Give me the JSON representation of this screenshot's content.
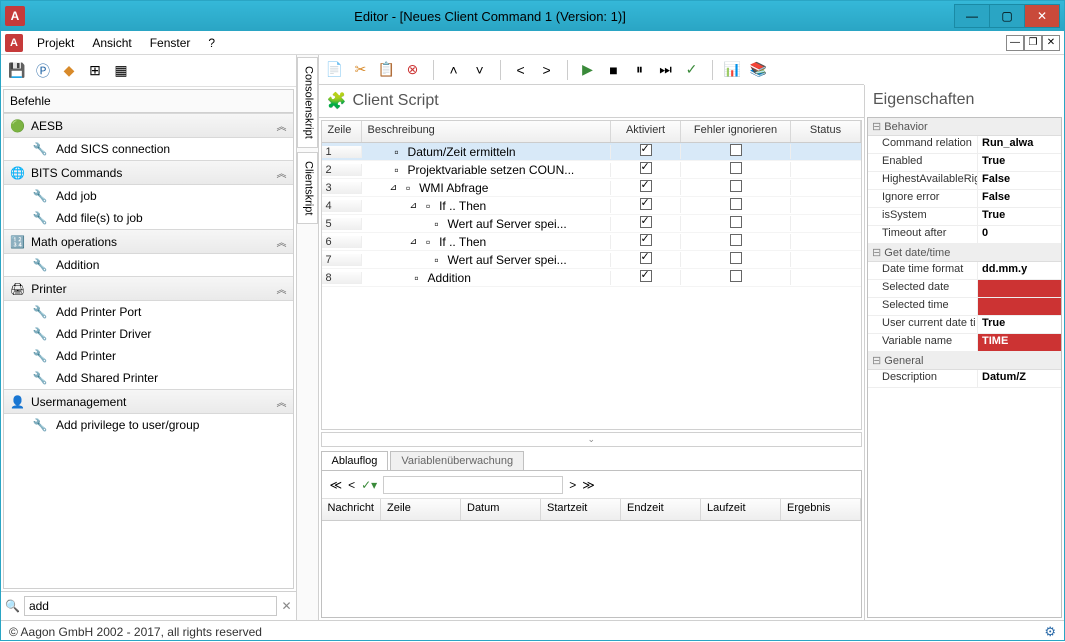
{
  "window": {
    "title": "Editor - [Neues Client Command 1 (Version: 1)]"
  },
  "menubar": {
    "projekt": "Projekt",
    "ansicht": "Ansicht",
    "fenster": "Fenster",
    "help": "?"
  },
  "left": {
    "title": "Befehle",
    "groups": [
      {
        "label": "AESB",
        "items": [
          {
            "label": "Add SICS connection"
          }
        ]
      },
      {
        "label": "BITS Commands",
        "items": [
          {
            "label": "Add job"
          },
          {
            "label": "Add file(s) to job"
          }
        ]
      },
      {
        "label": "Math operations",
        "items": [
          {
            "label": "Addition"
          }
        ]
      },
      {
        "label": "Printer",
        "items": [
          {
            "label": "Add Printer Port"
          },
          {
            "label": "Add Printer Driver"
          },
          {
            "label": "Add Printer"
          },
          {
            "label": "Add Shared Printer"
          }
        ]
      },
      {
        "label": "Usermanagement",
        "items": [
          {
            "label": "Add privilege to user/group"
          }
        ]
      }
    ],
    "search_value": "add"
  },
  "vtabs": {
    "top": "Consolenskript",
    "bottom": "Clientskript"
  },
  "clientscript": {
    "title": "Client Script",
    "columns": {
      "zeile": "Zeile",
      "beschreibung": "Beschreibung",
      "aktiviert": "Aktiviert",
      "fehler": "Fehler ignorieren",
      "status": "Status"
    },
    "rows": [
      {
        "n": "1",
        "indent": 0,
        "desc": "Datum/Zeit ermitteln",
        "akt": true,
        "fehl": false,
        "sel": true
      },
      {
        "n": "2",
        "indent": 0,
        "desc": "Projektvariable setzen COUN...",
        "akt": true,
        "fehl": false
      },
      {
        "n": "3",
        "indent": 0,
        "desc": "WMI Abfrage",
        "akt": true,
        "fehl": false,
        "expander": "⊿"
      },
      {
        "n": "4",
        "indent": 1,
        "desc": "If .. Then",
        "akt": true,
        "fehl": false,
        "expander": "⊿"
      },
      {
        "n": "5",
        "indent": 2,
        "desc": "Wert auf Server spei...",
        "akt": true,
        "fehl": false
      },
      {
        "n": "6",
        "indent": 1,
        "desc": "If .. Then",
        "akt": true,
        "fehl": false,
        "expander": "⊿"
      },
      {
        "n": "7",
        "indent": 2,
        "desc": "Wert auf Server spei...",
        "akt": true,
        "fehl": false
      },
      {
        "n": "8",
        "indent": 1,
        "desc": "Addition",
        "akt": true,
        "fehl": false
      }
    ]
  },
  "tabs": {
    "ablauflog": "Ablauflog",
    "variablen": "Variablenüberwachung"
  },
  "log": {
    "columns": {
      "nachricht": "Nachricht",
      "zeile": "Zeile",
      "datum": "Datum",
      "startzeit": "Startzeit",
      "endzeit": "Endzeit",
      "laufzeit": "Laufzeit",
      "ergebnis": "Ergebnis"
    }
  },
  "props": {
    "title": "Eigenschaften",
    "groups": [
      {
        "name": "Behavior",
        "rows": [
          {
            "k": "Command relation",
            "v": "Run_alwa"
          },
          {
            "k": "Enabled",
            "v": "True"
          },
          {
            "k": "HighestAvailableRig",
            "v": "False"
          },
          {
            "k": "Ignore error",
            "v": "False"
          },
          {
            "k": "isSystem",
            "v": "True"
          },
          {
            "k": "Timeout after",
            "v": "0"
          }
        ]
      },
      {
        "name": "Get date/time",
        "rows": [
          {
            "k": "Date time format",
            "v": "dd.mm.y"
          },
          {
            "k": "Selected date",
            "v": "",
            "red": true
          },
          {
            "k": "Selected time",
            "v": "",
            "red": true
          },
          {
            "k": "User current date ti",
            "v": "True"
          },
          {
            "k": "Variable name",
            "v": "TIME",
            "red": true
          }
        ]
      },
      {
        "name": "General",
        "rows": [
          {
            "k": "Description",
            "v": "Datum/Z"
          }
        ]
      }
    ]
  },
  "status": {
    "copyright": "© Aagon GmbH 2002 - 2017, all rights reserved"
  }
}
